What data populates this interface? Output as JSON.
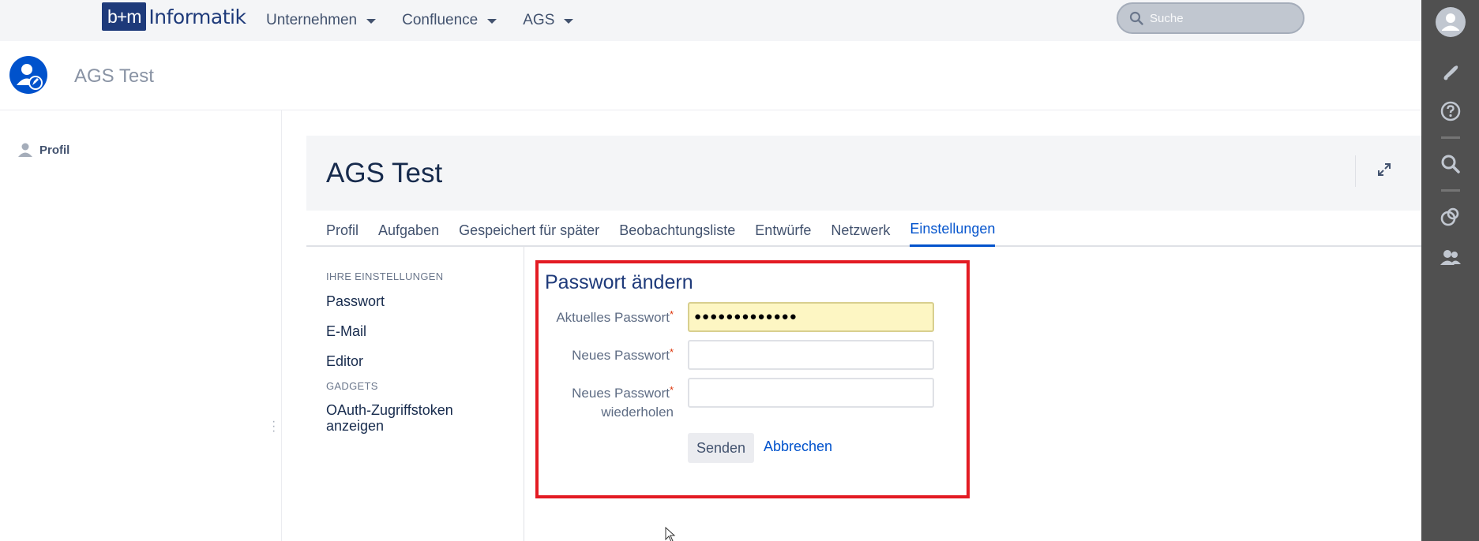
{
  "header": {
    "logo_box": "b+m",
    "logo_text": "Informatik",
    "nav": [
      {
        "label": "Unternehmen"
      },
      {
        "label": "Confluence"
      },
      {
        "label": "AGS"
      }
    ],
    "search_placeholder": "Suche"
  },
  "right_sidebar": {
    "icons": [
      "avatar-icon",
      "notifications-icon",
      "help-icon",
      "search-icon",
      "tasks-icon",
      "people-icon"
    ]
  },
  "profile": {
    "name": "AGS Test"
  },
  "left_nav": {
    "profile_label": "Profil"
  },
  "page": {
    "title": "AGS Test",
    "tabs": [
      {
        "label": "Profil",
        "active": false
      },
      {
        "label": "Aufgaben",
        "active": false
      },
      {
        "label": "Gespeichert für später",
        "active": false
      },
      {
        "label": "Beobachtungsliste",
        "active": false
      },
      {
        "label": "Entwürfe",
        "active": false
      },
      {
        "label": "Netzwerk",
        "active": false
      },
      {
        "label": "Einstellungen",
        "active": true
      }
    ]
  },
  "settings_menu": {
    "section_settings": "IHRE EINSTELLUNGEN",
    "password": "Passwort",
    "email": "E-Mail",
    "editor": "Editor",
    "section_gadgets": "GADGETS",
    "oauth_line1": "OAuth-Zugriffstoken",
    "oauth_line2": "anzeigen"
  },
  "form": {
    "title": "Passwort ändern",
    "current_label": "Aktuelles Passwort",
    "current_value": "●●●●●●●●●●●●●",
    "new_label": "Neues Passwort",
    "repeat_label_line1": "Neues Passwort",
    "repeat_label_line2": "wiederholen",
    "required_mark": "*",
    "submit": "Senden",
    "cancel": "Abbrechen"
  },
  "colors": {
    "brand": "#1e3a7a",
    "link": "#0052cc",
    "highlight_border": "#e31b23",
    "filled_input": "#fdf6c3",
    "right_sidebar": "#505050"
  }
}
